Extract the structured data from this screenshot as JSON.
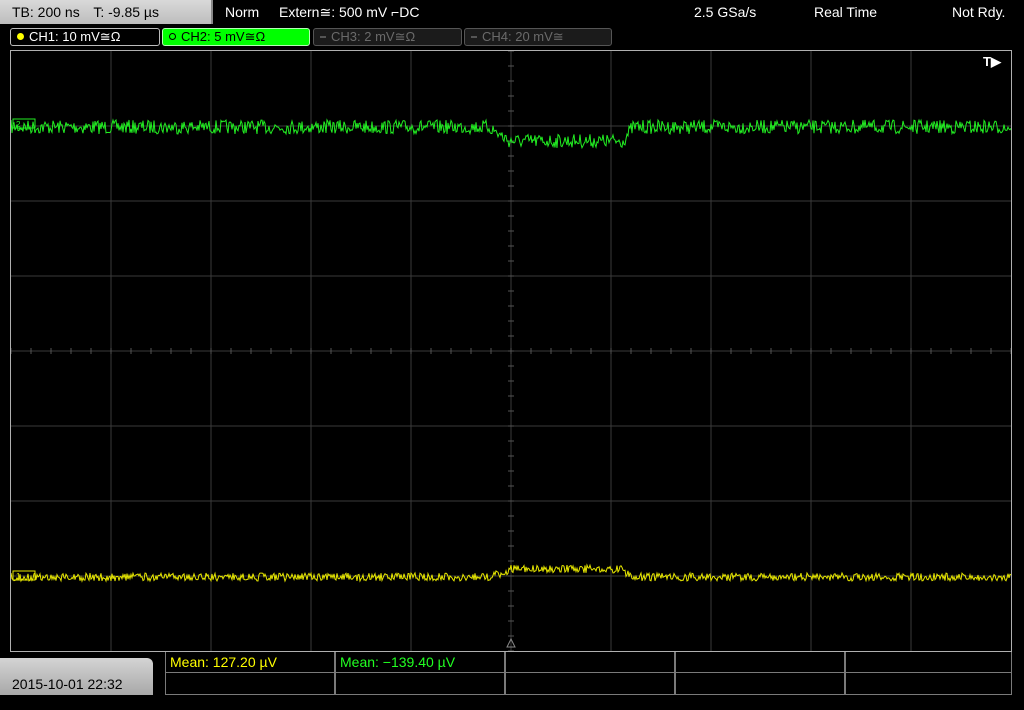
{
  "topbar": {
    "timebase": "TB: 200 ns",
    "trigger_offset": "T: -9.85 µs",
    "mode": "Norm",
    "trigger_source": "Extern≅: 500 mV ⌐DC",
    "sample_rate": "2.5 GSa/s",
    "acq_mode": "Real Time",
    "status": "Not Rdy."
  },
  "channels": [
    {
      "label": "CH1: 10 mV≅Ω",
      "color": "#ffff00",
      "active": true
    },
    {
      "label": "CH2: 5 mV≅Ω",
      "color": "#00ff00",
      "active": true,
      "selected": true
    },
    {
      "label": "CH3: 2 mV≅Ω",
      "color": "#666666",
      "active": false
    },
    {
      "label": "CH4: 20 mV≅",
      "color": "#666666",
      "active": false
    }
  ],
  "screen": {
    "trigger_marker": "T▶"
  },
  "date": "2015-10-01 22:32",
  "measurements": [
    {
      "label": "Mean: 127.20 µV",
      "color": "#ffff00"
    },
    {
      "label": "Mean: −139.40 µV",
      "color": "#22ff22"
    }
  ]
}
